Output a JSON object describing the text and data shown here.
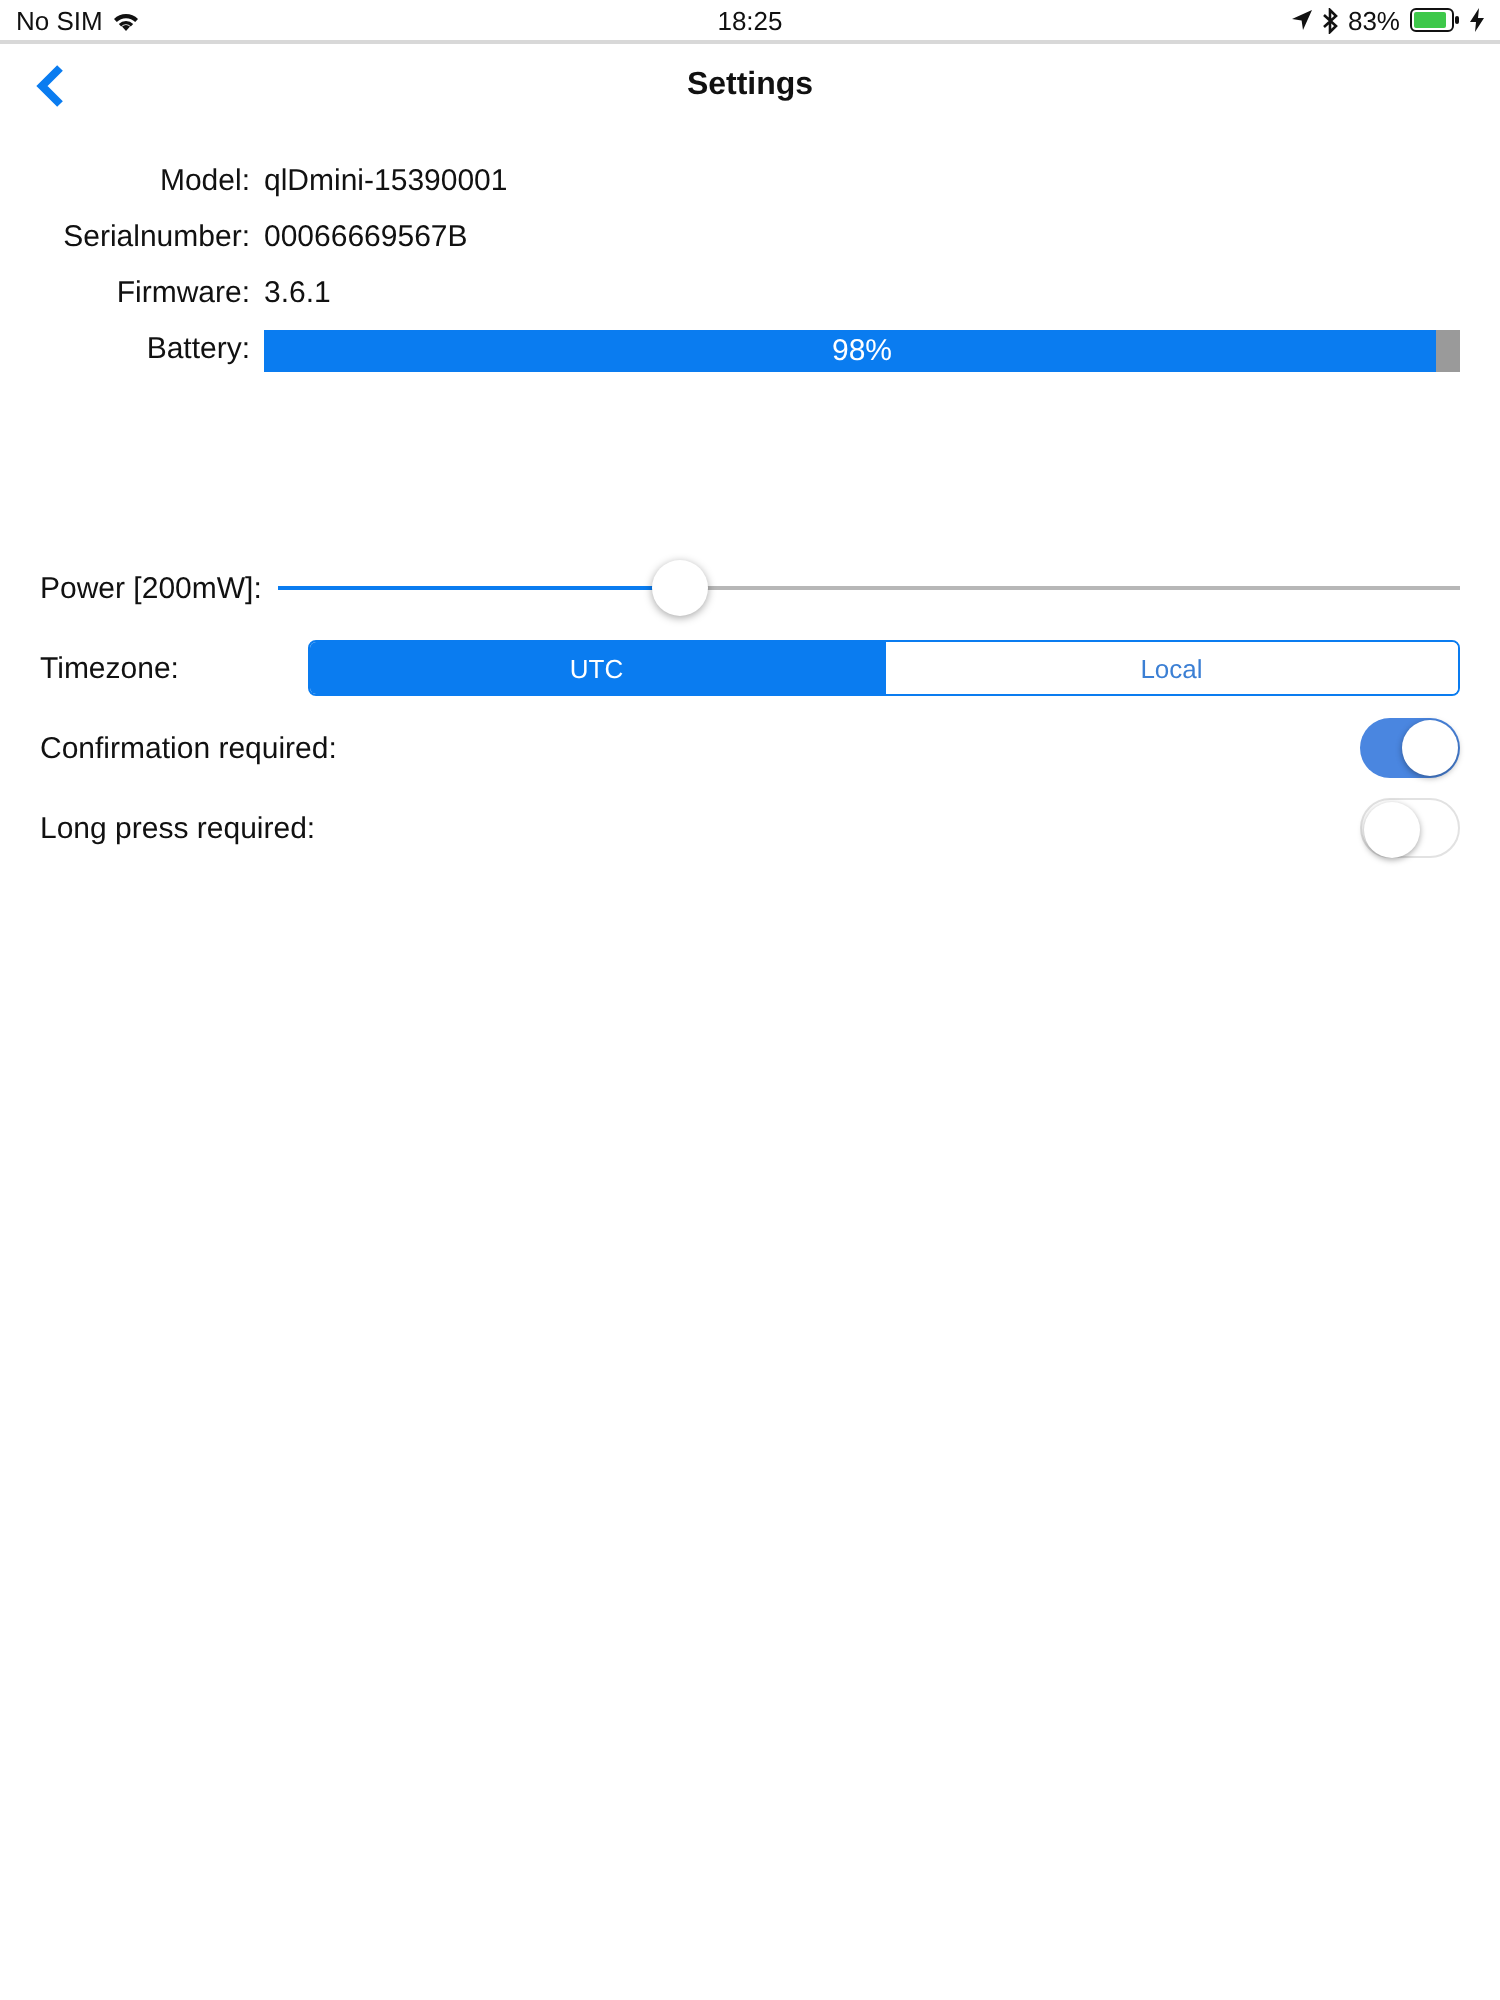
{
  "status_bar": {
    "carrier": "No SIM",
    "time": "18:25",
    "battery_percent": "83%"
  },
  "nav": {
    "title": "Settings"
  },
  "info": [
    {
      "label": "Model:",
      "value": "qlDmini-15390001"
    },
    {
      "label": "Serialnumber:",
      "value": "00066669567B"
    },
    {
      "label": "Firmware:",
      "value": "3.6.1"
    }
  ],
  "battery": {
    "label": "Battery:",
    "level": 0.98,
    "reading": "98%"
  },
  "power": {
    "label": "Power [200mW]:",
    "level": 0.34
  },
  "timezone": {
    "label": "Timezone:",
    "segments": [
      {
        "label": "UTC",
        "selected": true
      },
      {
        "label": "Local",
        "selected": false
      }
    ]
  },
  "toggles": [
    {
      "label": "Confirmation required:",
      "on": true
    },
    {
      "label": "Long press required:",
      "on": false
    }
  ]
}
